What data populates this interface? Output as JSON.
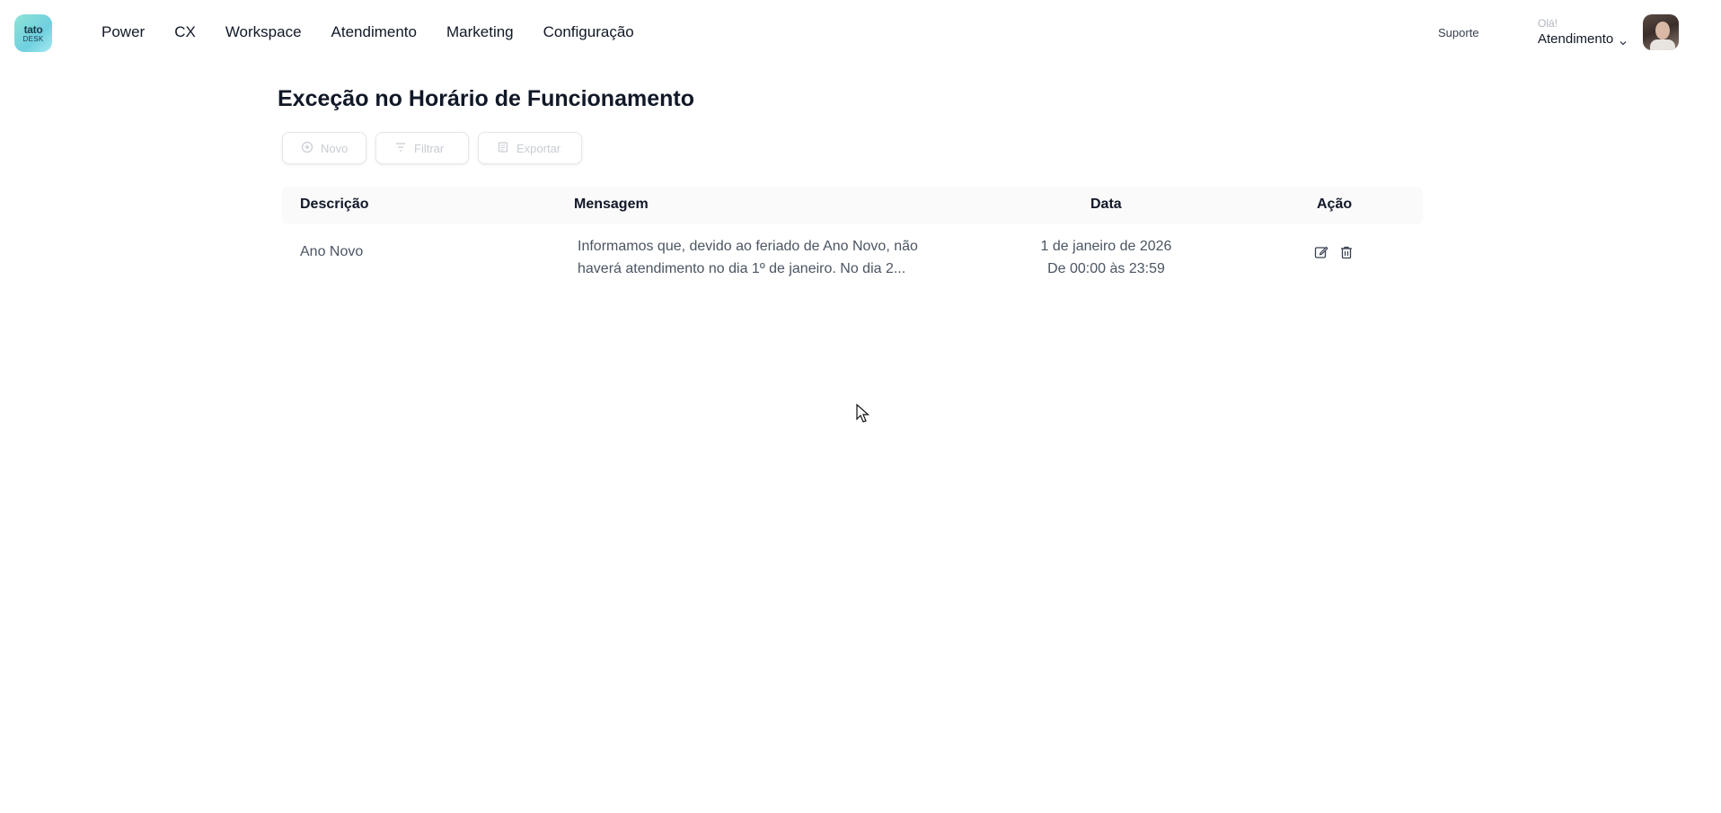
{
  "logo": {
    "line1": "tato",
    "line2": "DESK"
  },
  "nav": {
    "items": [
      {
        "label": "Power"
      },
      {
        "label": "CX"
      },
      {
        "label": "Workspace"
      },
      {
        "label": "Atendimento"
      },
      {
        "label": "Marketing"
      },
      {
        "label": "Configuração"
      }
    ]
  },
  "header": {
    "support_label": "Suporte",
    "org_label": "Olá!",
    "org_name": "Atendimento"
  },
  "page": {
    "title": "Exceção no Horário de Funcionamento"
  },
  "toolbar": {
    "new_label": "Novo",
    "filter_label": "Filtrar",
    "export_label": "Exportar"
  },
  "table": {
    "columns": [
      "Descrição",
      "Mensagem",
      "Data",
      "Ação"
    ],
    "rows": [
      {
        "description": "Ano Novo",
        "message_line1": "Informamos que, devido ao feriado de Ano Novo, não",
        "message_line2": "haverá atendimento no dia 1º de janeiro. No dia 2...",
        "date_line1": "1 de janeiro de 2026",
        "date_line2": "De 00:00 às 23:59"
      }
    ]
  },
  "icons": {
    "edit": "edit-icon",
    "delete": "trash-icon",
    "chevron": "chevron-down-icon"
  }
}
